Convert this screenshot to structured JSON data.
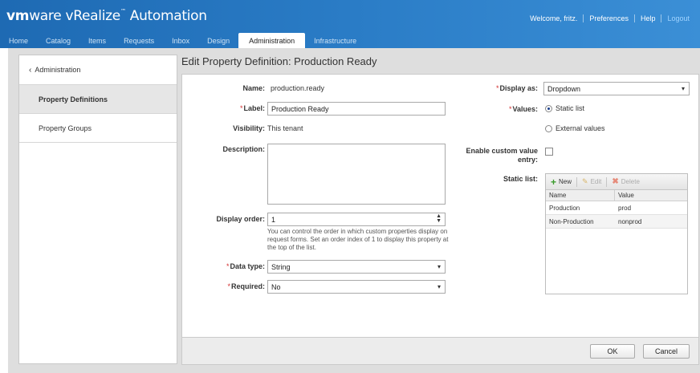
{
  "header": {
    "logo_vm": "vm",
    "logo_ware": "ware",
    "logo_product": " vRealize",
    "logo_suffix": " Automation",
    "welcome": "Welcome, fritz.",
    "preferences": "Preferences",
    "help": "Help",
    "logout": "Logout"
  },
  "tabs": [
    "Home",
    "Catalog",
    "Items",
    "Requests",
    "Inbox",
    "Design",
    "Administration",
    "Infrastructure"
  ],
  "sidebar": {
    "back": "Administration",
    "items": [
      {
        "label": "Property Definitions"
      },
      {
        "label": "Property Groups"
      }
    ]
  },
  "page_title": "Edit Property Definition: Production Ready",
  "form": {
    "name_label": "Name:",
    "name_value": "production.ready",
    "label_label": "Label:",
    "label_value": "Production Ready",
    "visibility_label": "Visibility:",
    "visibility_value": "This tenant",
    "description_label": "Description:",
    "display_order_label": "Display order:",
    "display_order_value": "1",
    "display_order_help": "You can control the order in which custom properties display on request forms. Set an order index of 1 to display this property at the top of the list.",
    "data_type_label": "Data type:",
    "data_type_value": "String",
    "required_label": "Required:",
    "required_value": "No",
    "display_as_label": "Display as:",
    "display_as_value": "Dropdown",
    "values_label": "Values:",
    "values_static": "Static list",
    "values_external": "External values",
    "custom_value_label_1": "Enable custom value",
    "custom_value_label_2": "entry:",
    "static_list_label": "Static list:"
  },
  "static_list": {
    "new": "New",
    "edit": "Edit",
    "delete": "Delete",
    "columns": [
      "Name",
      "Value"
    ],
    "rows": [
      {
        "name": "Production",
        "value": "prod"
      },
      {
        "name": "Non-Production",
        "value": "nonprod"
      }
    ]
  },
  "buttons": {
    "ok": "OK",
    "cancel": "Cancel"
  }
}
